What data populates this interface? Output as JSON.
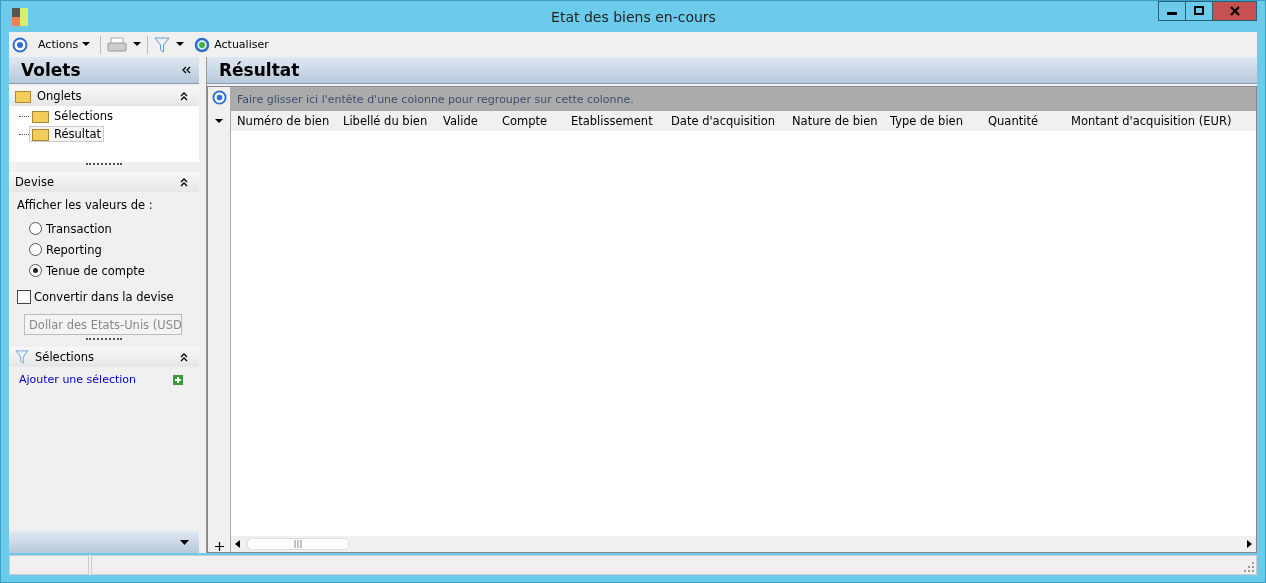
{
  "window": {
    "title": "Etat des biens en-cours"
  },
  "toolbar": {
    "actions": "Actions",
    "refresh": "Actualiser"
  },
  "sidebar": {
    "title": "Volets",
    "tabs_section": {
      "title": "Onglets",
      "items": [
        {
          "label": "Sélections",
          "selected": false
        },
        {
          "label": "Résultat",
          "selected": true
        }
      ]
    },
    "currency": {
      "title": "Devise",
      "prompt": "Afficher les valeurs de :",
      "options": [
        {
          "label": "Transaction",
          "selected": false
        },
        {
          "label": "Reporting",
          "selected": false
        },
        {
          "label": "Tenue de compte",
          "selected": true
        }
      ],
      "convert": {
        "label": "Convertir dans la devise",
        "checked": false
      },
      "currency_select": {
        "value": "Dollar des Etats-Unis (USD",
        "disabled": true
      }
    },
    "selections": {
      "title": "Sélections",
      "add_link": "Ajouter une sélection"
    }
  },
  "result": {
    "title": "Résultat",
    "group_hint": "Faire glisser ici l'entête d'une colonne pour regrouper sur cette colonne.",
    "columns": [
      "Numéro de bien",
      "Libellé du bien",
      "Valide",
      "Compte",
      "Etablissement",
      "Date d'acquisition",
      "Nature de bien",
      "Type de bien",
      "Quantité",
      "Montant d'acquisition (EUR)"
    ]
  }
}
